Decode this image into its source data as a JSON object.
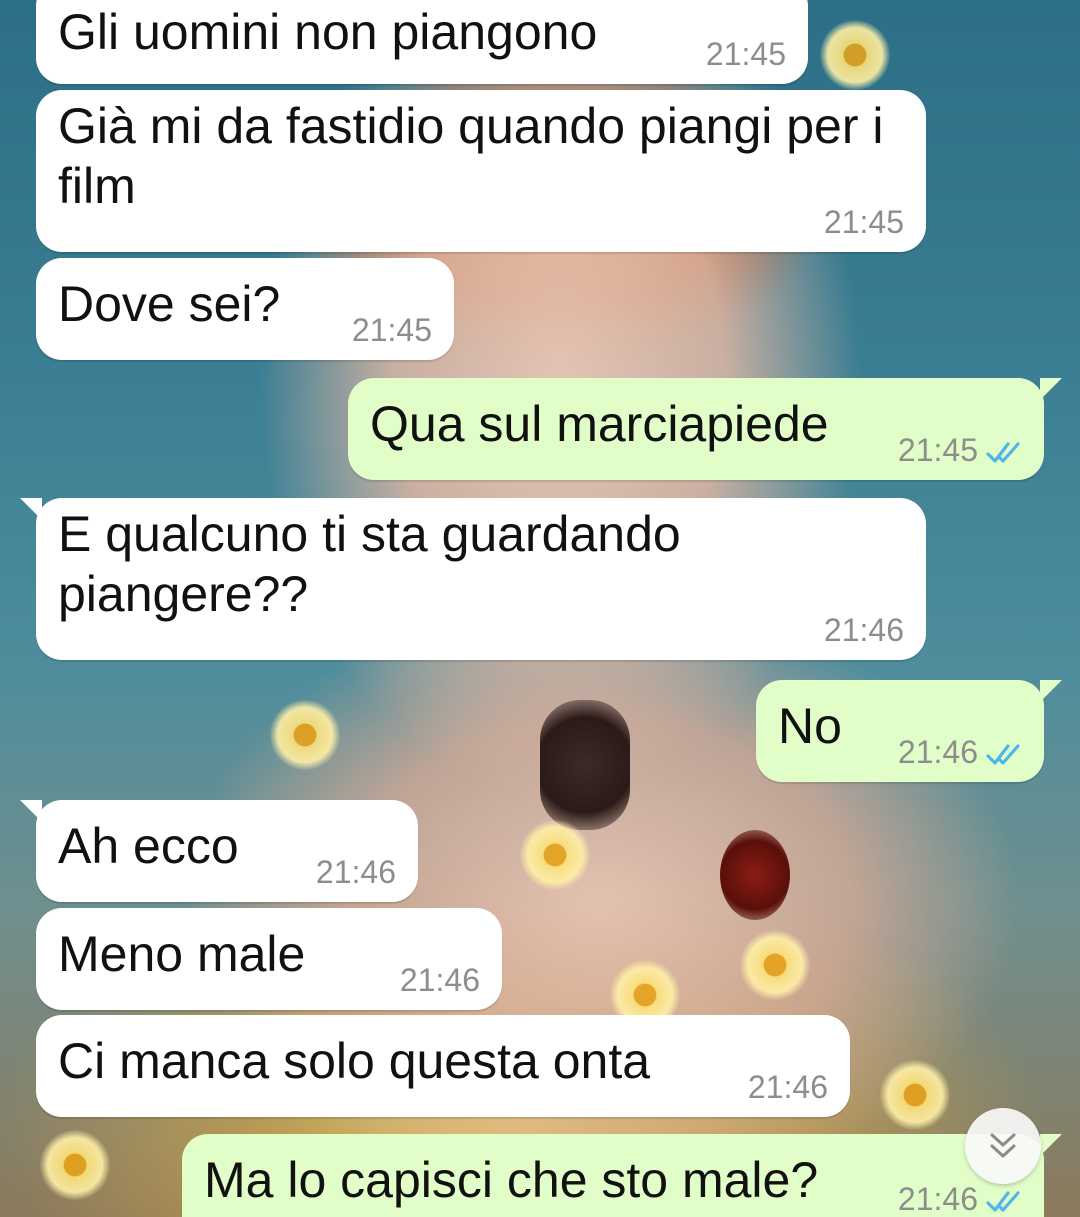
{
  "colors": {
    "incoming_bubble": "#ffffff",
    "outgoing_bubble": "#e2fec8",
    "time_text": "#8d8d8d",
    "read_ticks": "#4fb6ec"
  },
  "messages": [
    {
      "direction": "in",
      "text": "Gli uomini non piangono",
      "time": "21:45"
    },
    {
      "direction": "in",
      "text": "Già mi da fastidio quando piangi per i film",
      "time": "21:45"
    },
    {
      "direction": "in",
      "text": "Dove sei?",
      "time": "21:45"
    },
    {
      "direction": "out",
      "text": "Qua sul marciapiede",
      "time": "21:45",
      "status": "read"
    },
    {
      "direction": "in",
      "text": "E qualcuno ti sta guardando piangere??",
      "time": "21:46"
    },
    {
      "direction": "out",
      "text": "No",
      "time": "21:46",
      "status": "read"
    },
    {
      "direction": "in",
      "text": "Ah ecco",
      "time": "21:46"
    },
    {
      "direction": "in",
      "text": "Meno male",
      "time": "21:46"
    },
    {
      "direction": "in",
      "text": "Ci manca solo questa onta",
      "time": "21:46"
    },
    {
      "direction": "out",
      "text": "Ma lo capisci che sto male?",
      "time": "21:46",
      "status": "read"
    }
  ],
  "scroll_button": {
    "icon": "double-chevron-down-icon"
  }
}
